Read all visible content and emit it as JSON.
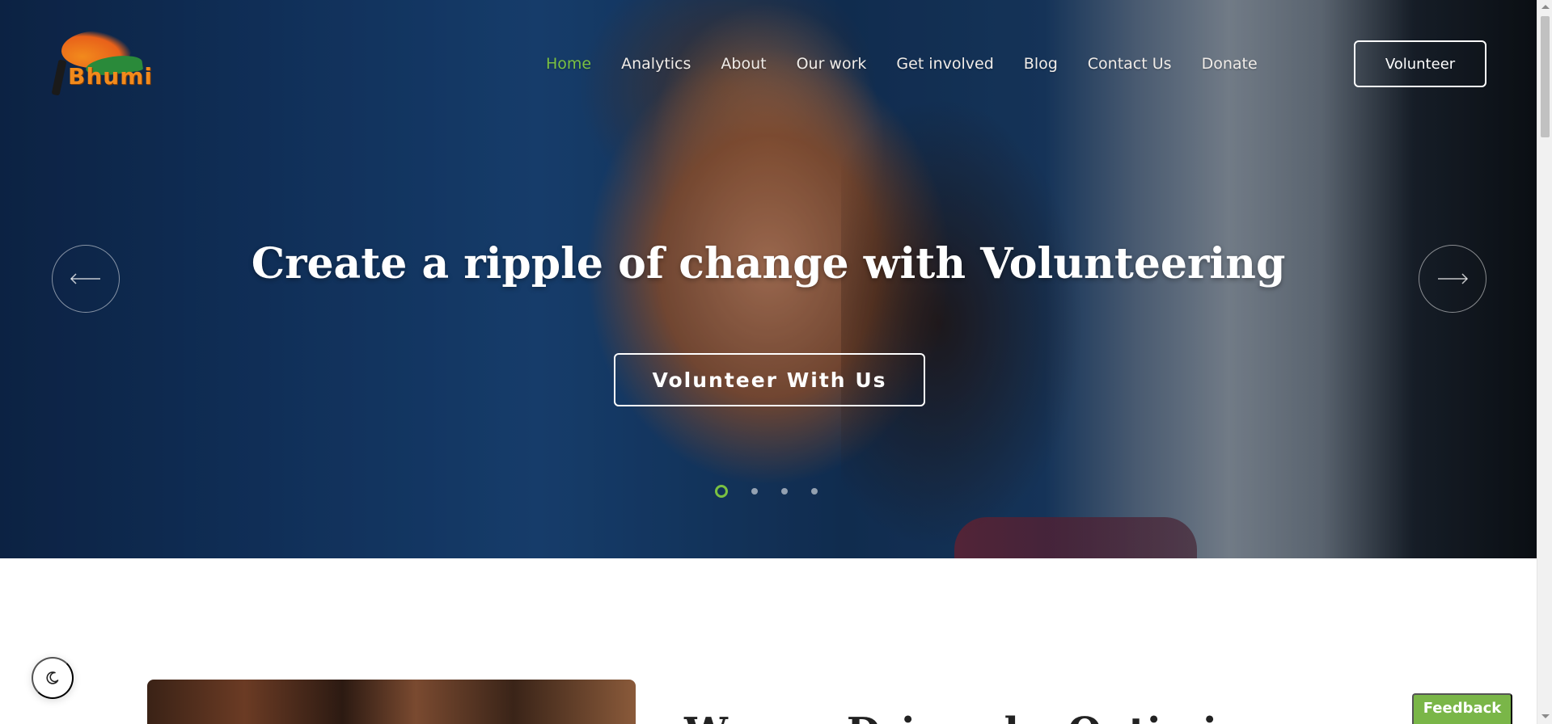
{
  "brand": {
    "name": "Bhumi"
  },
  "nav": {
    "items": [
      {
        "label": "Home",
        "active": true
      },
      {
        "label": "Analytics"
      },
      {
        "label": "About"
      },
      {
        "label": "Our work"
      },
      {
        "label": "Get involved"
      },
      {
        "label": "Blog"
      },
      {
        "label": "Contact Us"
      },
      {
        "label": "Donate"
      }
    ],
    "cta_label": "Volunteer"
  },
  "hero": {
    "title": "Create a ripple of change with Volunteering",
    "button_label": "Volunteer With Us",
    "slide_count": 4,
    "active_slide": 1
  },
  "section": {
    "title": "We are Driven by Optimism"
  },
  "feedback_label": "Feedback",
  "colors": {
    "accent": "#7ac142",
    "feedback": "#7ab648",
    "text_light": "#ffffff"
  },
  "icons": {
    "prev": "arrow-left-icon",
    "next": "arrow-right-icon",
    "theme": "moon-icon"
  }
}
